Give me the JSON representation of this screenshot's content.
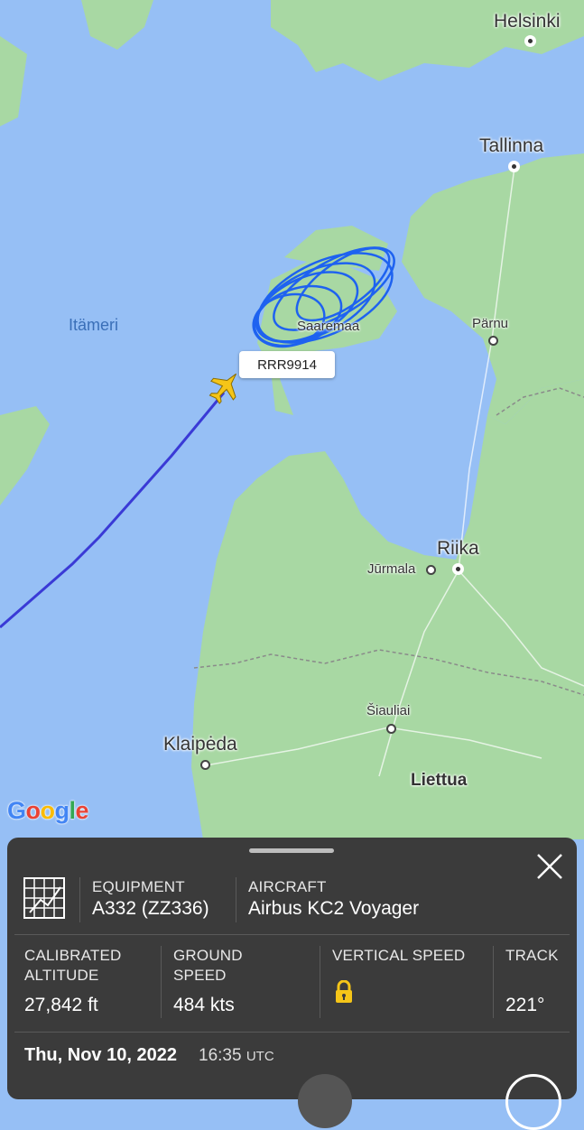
{
  "map": {
    "cities": {
      "helsinki": "Helsinki",
      "tallinna": "Tallinna",
      "parnu": "Pärnu",
      "saaremaa": "Saaremaa",
      "riika": "Riika",
      "jurmala": "Jūrmala",
      "siauliai": "Šiauliai",
      "klaipeda": "Klaipėda"
    },
    "sea": "Itämeri",
    "country": "Liettua",
    "attribution": "Google",
    "colors": {
      "water": "#96bff5",
      "land": "#a8d8a3",
      "flight_track": "#3a3ad6",
      "holding_track": "#1e62f0",
      "aircraft": "#f5c518"
    }
  },
  "flight": {
    "callsign": "RRR9914"
  },
  "panel": {
    "equipment": {
      "label": "EQUIPMENT",
      "value": "A332 (ZZ336)"
    },
    "aircraft": {
      "label": "AIRCRAFT",
      "value": "Airbus KC2 Voyager"
    },
    "calibrated_altitude": {
      "label_line1": "CALIBRATED",
      "label_line2": "ALTITUDE",
      "value": "27,842 ft"
    },
    "ground_speed": {
      "label_line1": "GROUND",
      "label_line2": "SPEED",
      "value": "484 kts"
    },
    "vertical_speed": {
      "label": "VERTICAL SPEED",
      "icon": "lock-icon"
    },
    "track": {
      "label": "TRACK",
      "value": "221°"
    },
    "date": "Thu, Nov 10, 2022",
    "time": "16:35",
    "timezone": "UTC"
  }
}
